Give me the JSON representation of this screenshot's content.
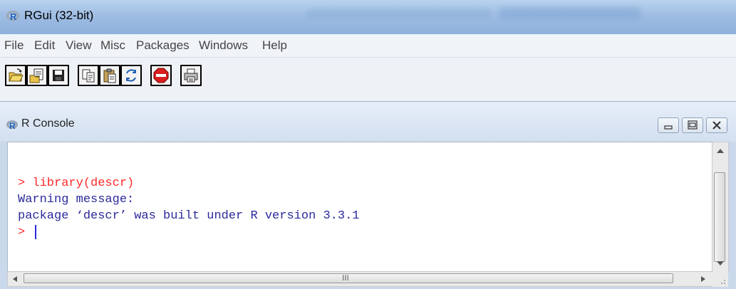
{
  "app": {
    "title": "RGui (32-bit)",
    "icon": "r-logo-icon"
  },
  "menu": {
    "items": [
      "File",
      "Edit",
      "View",
      "Misc",
      "Packages",
      "Windows",
      "Help"
    ]
  },
  "toolbar": {
    "buttons": [
      "open-script-icon",
      "load-workspace-icon",
      "save-workspace-icon",
      "copy-icon",
      "paste-icon",
      "copy-paste-icon",
      "stop-icon",
      "print-icon"
    ]
  },
  "console_window": {
    "title": "R Console",
    "lines": [
      "> library(descr)",
      "Warning message:",
      "package ‘descr’ was built under R version 3.3.1",
      "> "
    ],
    "colors": {
      "input": "#ff2a2a",
      "output": "#2a2a9c"
    },
    "scroll_glyph": "III"
  }
}
